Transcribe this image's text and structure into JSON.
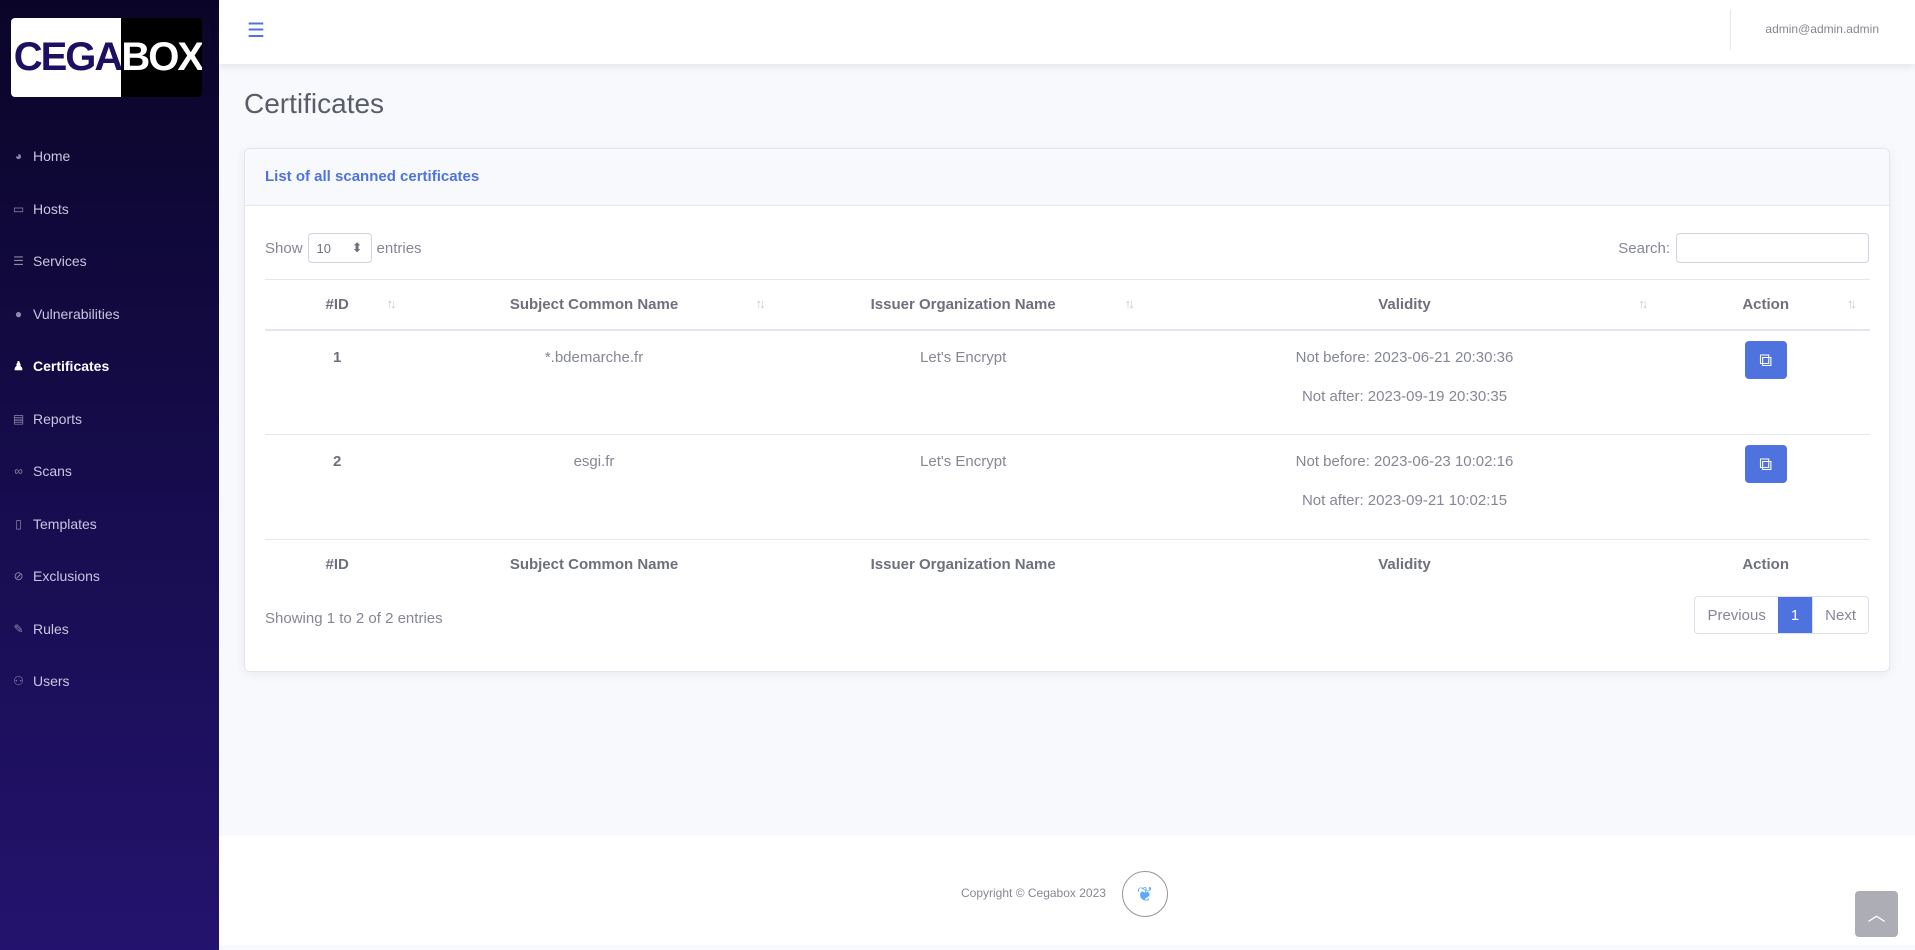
{
  "logo": {
    "left": "CEGA",
    "right": "BOX"
  },
  "sidebar": {
    "items": [
      {
        "label": "Home",
        "icon": "palette-icon",
        "glyph": "◕"
      },
      {
        "label": "Hosts",
        "icon": "desktop-icon",
        "glyph": "▭"
      },
      {
        "label": "Services",
        "icon": "server-icon",
        "glyph": "☰"
      },
      {
        "label": "Vulnerabilities",
        "icon": "exclamation-circle-icon",
        "glyph": "●"
      },
      {
        "label": "Certificates",
        "icon": "stamp-icon",
        "glyph": "♟",
        "active": true
      },
      {
        "label": "Reports",
        "icon": "file-pdf-icon",
        "glyph": "▤"
      },
      {
        "label": "Scans",
        "icon": "binoculars-icon",
        "glyph": "∞"
      },
      {
        "label": "Templates",
        "icon": "file-icon",
        "glyph": "▯"
      },
      {
        "label": "Exclusions",
        "icon": "bell-slash-icon",
        "glyph": "⊘"
      },
      {
        "label": "Rules",
        "icon": "ruler-icon",
        "glyph": "✎"
      },
      {
        "label": "Users",
        "icon": "users-icon",
        "glyph": "⚇"
      }
    ]
  },
  "topbar": {
    "user": "admin@admin.admin"
  },
  "page": {
    "title": "Certificates"
  },
  "card": {
    "title": "List of all scanned certificates",
    "show_label": "Show",
    "entries_label": "entries",
    "page_length": "10",
    "search_label": "Search:",
    "search_value": "",
    "columns": [
      "#ID",
      "Subject Common Name",
      "Issuer Organization Name",
      "Validity",
      "Action"
    ],
    "rows": [
      {
        "id": "1",
        "subject": "*.bdemarche.fr",
        "issuer": "Let's Encrypt",
        "not_before": "Not before: 2023-06-21 20:30:36",
        "not_after": "Not after: 2023-09-19 20:30:35"
      },
      {
        "id": "2",
        "subject": "esgi.fr",
        "issuer": "Let's Encrypt",
        "not_before": "Not before: 2023-06-23 10:02:16",
        "not_after": "Not after: 2023-09-21 10:02:15"
      }
    ],
    "info": "Showing 1 to 2 of 2 entries",
    "pagination": {
      "previous": "Previous",
      "current": "1",
      "next": "Next"
    }
  },
  "footer": {
    "copyright": "Copyright © Cegabox 2023"
  },
  "colors": {
    "accent": "#4e73df",
    "sidebar_top": "#0a0528",
    "sidebar_bottom": "#24136e"
  }
}
